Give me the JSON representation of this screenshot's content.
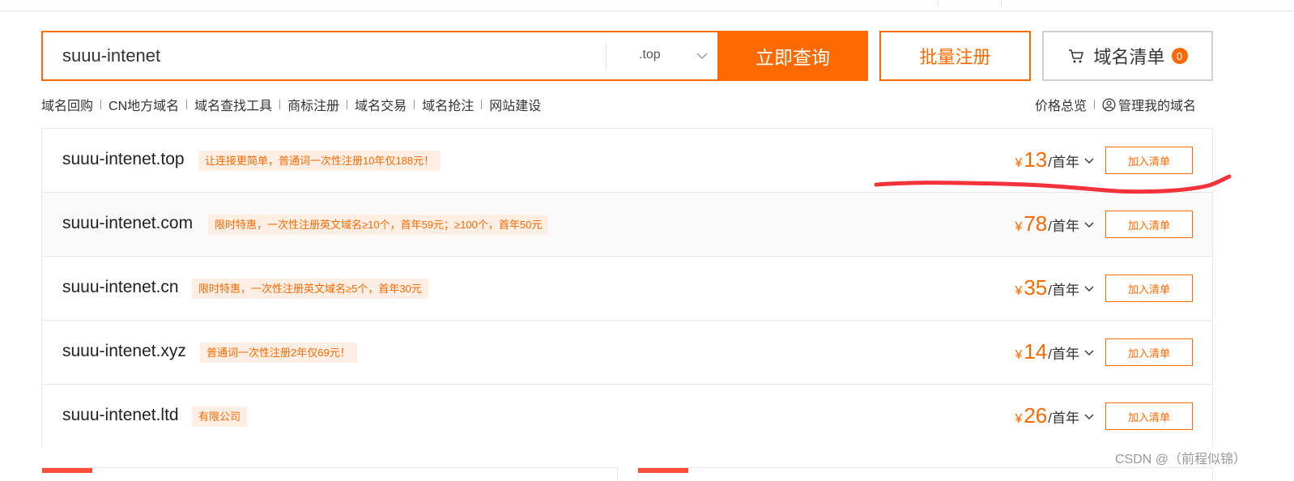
{
  "search": {
    "query": "suuu-intenet",
    "tld": ".top",
    "query_button": "立即查询",
    "batch_button": "批量注册",
    "cart_label": "域名清单",
    "cart_count": "0"
  },
  "subnav": {
    "left": [
      "域名回购",
      "CN地方域名",
      "域名查找工具",
      "商标注册",
      "域名交易",
      "域名抢注",
      "网站建设"
    ],
    "price_overview": "价格总览",
    "manage": "管理我的域名"
  },
  "results": [
    {
      "domain": "suuu-intenet.top",
      "promo": "让连接更简单，普通词一次性注册10年仅188元！",
      "currency": "¥",
      "price": "13",
      "unit": "/首年",
      "add_label": "加入清单"
    },
    {
      "domain": "suuu-intenet.com",
      "promo": "限时特惠，一次性注册英文域名≥10个，首年59元；≥100个，首年50元",
      "currency": "¥",
      "price": "78",
      "unit": "/首年",
      "add_label": "加入清单"
    },
    {
      "domain": "suuu-intenet.cn",
      "promo": "限时特惠，一次性注册英文域名≥5个，首年30元",
      "currency": "¥",
      "price": "35",
      "unit": "/首年",
      "add_label": "加入清单"
    },
    {
      "domain": "suuu-intenet.xyz",
      "promo": "普通词一次性注册2年仅69元！",
      "currency": "¥",
      "price": "14",
      "unit": "/首年",
      "add_label": "加入清单"
    },
    {
      "domain": "suuu-intenet.ltd",
      "promo": "有限公司",
      "currency": "¥",
      "price": "26",
      "unit": "/首年",
      "add_label": "加入清单"
    }
  ],
  "watermark": "CSDN @（前程似锦）",
  "colors": {
    "accent": "#ff6a00",
    "promo_bg": "#ffeee4",
    "annotation": "#f2333c"
  },
  "icons": {
    "cart": "shopping-cart-icon",
    "user": "user-circle-icon",
    "chevron": "chevron-down-icon"
  }
}
